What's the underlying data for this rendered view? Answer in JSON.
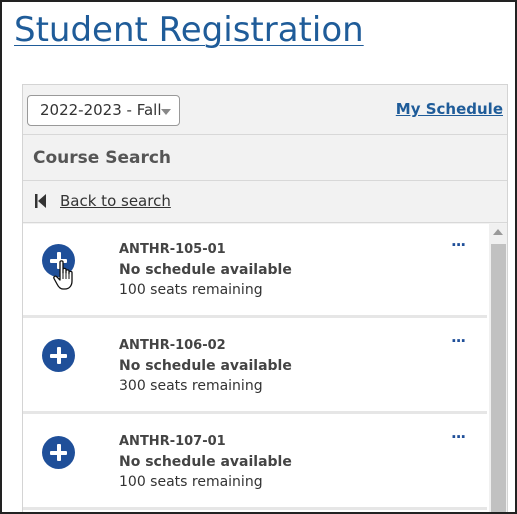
{
  "page": {
    "title": "Student Registration"
  },
  "toolbar": {
    "term_selected": "2022-2023 - Fall",
    "my_schedule_label": "My Schedule"
  },
  "section": {
    "title": "Course Search"
  },
  "back": {
    "label": "Back to search"
  },
  "courses": [
    {
      "code": "ANTHR-105-01",
      "schedule": "No schedule available",
      "seats": "100 seats remaining",
      "more": "···"
    },
    {
      "code": "ANTHR-106-02",
      "schedule": "No schedule available",
      "seats": "300 seats remaining",
      "more": "···"
    },
    {
      "code": "ANTHR-107-01",
      "schedule": "No schedule available",
      "seats": "100 seats remaining",
      "more": "···"
    }
  ],
  "colors": {
    "brand": "#1f5c99",
    "add_button": "#1f4f99"
  }
}
